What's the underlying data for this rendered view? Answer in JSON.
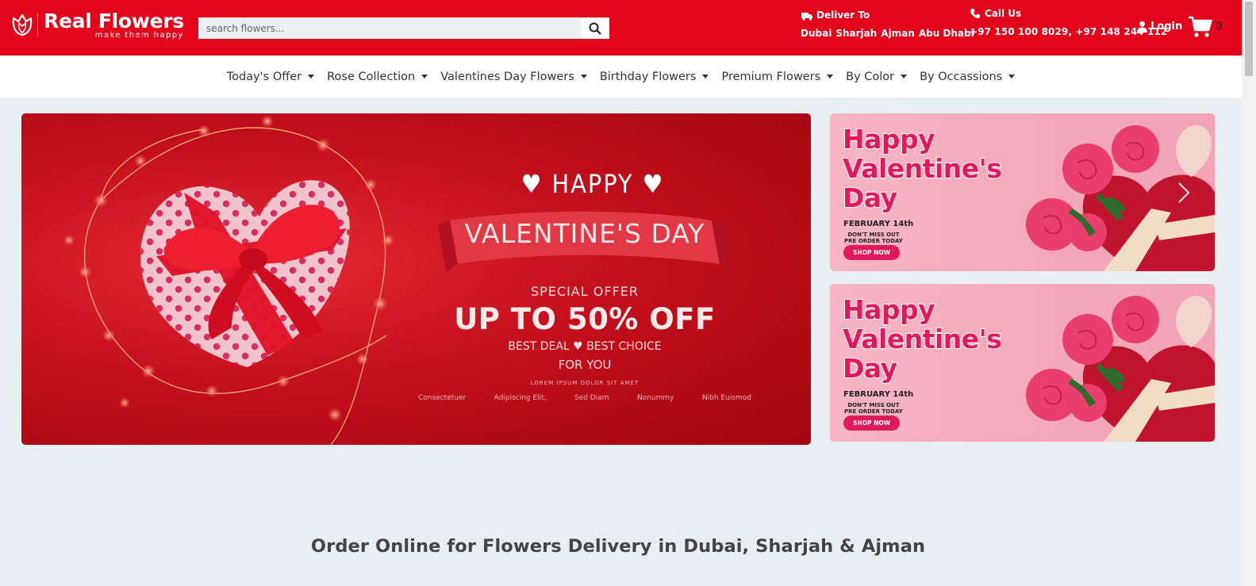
{
  "header": {
    "brand_name": "Real Flowers",
    "brand_tagline": "make them happy",
    "search_placeholder": "search flowers...",
    "deliver_label": "Deliver To",
    "cities": [
      "Dubai",
      "Sharjah",
      "Ajman",
      "Abu Dhabi"
    ],
    "call_label": "Call Us",
    "phone_numbers": "+97 150 100 8029, +97 148 244 112",
    "login_label": "Login",
    "cart_count": "0",
    "colors": {
      "brand_red": "#e3051b",
      "page_bg": "#e8eff2"
    }
  },
  "nav": {
    "items": [
      "Today's Offer",
      "Rose Collection",
      "Valentines Day Flowers",
      "Birthday Flowers",
      "Premium Flowers",
      "By Color",
      "By Occassions"
    ]
  },
  "hero": {
    "happy": "HAPPY",
    "title": "VALENTINE'S DAY",
    "special": "SPECIAL OFFER",
    "offer": "UP TO 50% OFF",
    "best_deal": "BEST DEAL",
    "best_choice": "BEST CHOICE",
    "for_you": "FOR YOU",
    "lorem": "LOREM IPSUM DOLOR SIT AMET",
    "words": [
      "Consectetuer",
      "Adipiscing Elit,",
      "Sed Diam",
      "Nonummy",
      "Nibh Euismod"
    ]
  },
  "side_banners": [
    {
      "title_lines": [
        "Happy",
        "Valentine's",
        "Day"
      ],
      "date": "FEBRUARY 14th",
      "line1": "DON'T MISS OUT",
      "line2": "PRE ORDER TODAY",
      "cta": "SHOP NOW"
    },
    {
      "title_lines": [
        "Happy",
        "Valentine's",
        "Day"
      ],
      "date": "FEBRUARY 14th",
      "line1": "DON'T MISS OUT",
      "line2": "PRE ORDER TODAY",
      "cta": "SHOP NOW"
    }
  ],
  "main": {
    "heading": "Order Online for Flowers Delivery in Dubai, Sharjah & Ajman"
  }
}
